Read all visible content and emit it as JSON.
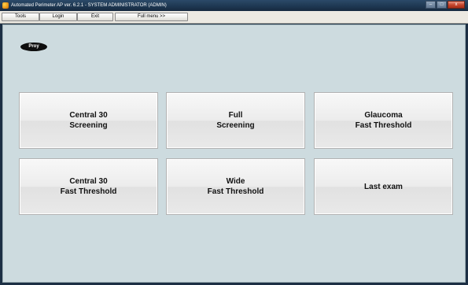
{
  "window": {
    "title": "Automated Perimeter AP ver. 6.2.1 - SYSTEM ADMINISTRATOR (ADMIN)",
    "controls": {
      "minimize": "–",
      "maximize": "□",
      "close": "x"
    }
  },
  "menu": {
    "tools": "Tools",
    "login": "Login",
    "exit": "Exit",
    "full_menu": "Full menu >>"
  },
  "badge": {
    "label": "Proy"
  },
  "tiles": [
    {
      "line1": "Central 30",
      "line2": "Screening"
    },
    {
      "line1": "Full",
      "line2": "Screening"
    },
    {
      "line1": "Glaucoma",
      "line2": "Fast Threshold"
    },
    {
      "line1": "Central 30",
      "line2": "Fast Threshold"
    },
    {
      "line1": "Wide",
      "line2": "Fast Threshold"
    },
    {
      "line1": "Last exam",
      "line2": ""
    }
  ],
  "colors": {
    "titlebar": "#1d3650",
    "workspace": "#cddbdf",
    "tile": "#ececec",
    "badge": "#0e0e0e"
  }
}
